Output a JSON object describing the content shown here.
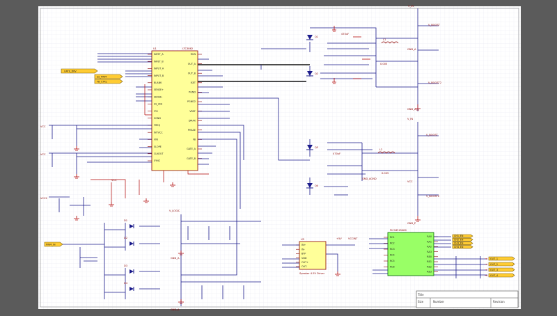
{
  "title_block": {
    "title_label": "Title",
    "number_label": "Number",
    "revision_label": "Revision",
    "size_label": "Size"
  },
  "ic_main": {
    "ref": "U1",
    "part": "LTC3862"
  },
  "ic_right": {
    "part": "PIC18F45K80"
  },
  "ic_mid": {
    "ref": "U3",
    "part": "Speaker 4.5V Driver"
  },
  "rails": {
    "vin": "V_IN",
    "v_boost": "V_BOOST",
    "v_boost2": "V_BOOST2",
    "vcc": "VCC",
    "vcc2": "VCC",
    "vcc3": "VCC2",
    "gnd_a": "GND_A",
    "gnd_p": "GND_P",
    "gnd_a_agnd": "GND_AGND",
    "v_logic": "V_LOGIC",
    "vcc_5v": "+5V",
    "vccint": "VCCINT"
  },
  "net_flags": [
    {
      "text": "GATE_DRV",
      "kind": "left"
    },
    {
      "text": "SS_PWM",
      "kind": "left"
    },
    {
      "text": "FB_CTRL",
      "kind": "left"
    },
    {
      "text": "PWM_IN",
      "kind": "left"
    },
    {
      "text": "CH1_EN",
      "kind": "right"
    },
    {
      "text": "CH2_EN",
      "kind": "right"
    },
    {
      "text": "CH3_EN",
      "kind": "right"
    },
    {
      "text": "CH4_EN",
      "kind": "right"
    },
    {
      "text": "OUT_1",
      "kind": "right"
    },
    {
      "text": "OUT_2",
      "kind": "right"
    },
    {
      "text": "OUT_3",
      "kind": "right"
    },
    {
      "text": "OUT_4",
      "kind": "right"
    }
  ],
  "ic_main_left_pins": [
    "INFET_A",
    "INFET_B",
    "INPUT_A",
    "INPUT_B",
    "BLANK",
    "SENSE+",
    "SENSE-",
    "SS_ADJ",
    "ITH",
    "SGND",
    "FREQ",
    "INTVCC",
    "VIN",
    "SLOPE",
    "CLKOUT",
    "SYNC"
  ],
  "ic_main_right_pins": [
    "RUN",
    "OUT_A",
    "OUT_B",
    "ISET",
    "PGND",
    "PGND2",
    "VREF",
    "DMAX",
    "PHASE",
    "FB",
    "GATE_A",
    "GATE_B"
  ],
  "ic_right_left_pins": [
    "RC1",
    "RC2",
    "RC3",
    "RC4",
    "RC5",
    "RC6"
  ],
  "ic_right_right_pins": [
    "RA0",
    "RA1",
    "RA2",
    "RA3",
    "RB0",
    "RB1",
    "RB2",
    "RB3"
  ],
  "ic_mid_pins": [
    "IN+",
    "IN-",
    "BYP",
    "VDD",
    "OUT+",
    "OUT-"
  ],
  "components": {
    "q1": "Q1",
    "q2": "Q2",
    "q3": "Q3",
    "q4": "Q4",
    "d1": "D1",
    "d2": "D2",
    "d3": "D3",
    "d4": "D4",
    "l1": "L1",
    "l2": "L2",
    "c_out1": "470uF",
    "c_out2": "470uF",
    "r_sense1": "0.005",
    "r_sense2": "0.005",
    "mosfet_part": "IRF7401"
  }
}
